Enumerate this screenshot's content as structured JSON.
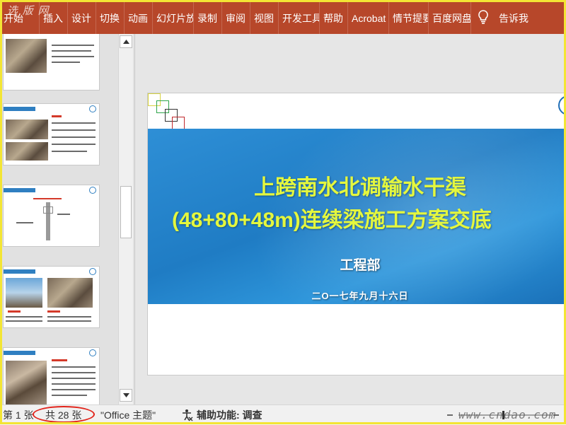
{
  "ribbon": {
    "watermark": "选 版 网",
    "tabs": [
      "开始",
      "插入",
      "设计",
      "切换",
      "动画",
      "幻灯片放映",
      "录制",
      "审阅",
      "视图",
      "开发工具",
      "帮助",
      "Acrobat",
      "情节提要",
      "百度网盘"
    ],
    "tell_me": "告诉我",
    "bulb_icon": "lightbulb-icon"
  },
  "slide": {
    "title_line1": "上跨南水北调输水干渠",
    "title_line2": "(48+80+48m)连续梁施工方案交底",
    "department": "工程部",
    "date": "二O一七年九月十六日",
    "colors": {
      "band": "#1f7cc4",
      "title": "#e4f73e"
    }
  },
  "status_bar": {
    "slide_position": "第 1 张",
    "slide_count": "共 28 张",
    "theme": "\"Office 主题\"",
    "accessibility": "辅助功能: 调查",
    "watermark": "www.cndao.com"
  },
  "scroll": {
    "up_icon": "triangle-up-icon",
    "down_icon": "triangle-down-icon"
  }
}
